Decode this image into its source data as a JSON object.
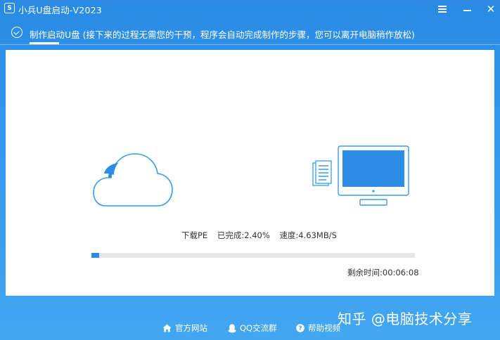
{
  "app": {
    "title": "小兵U盘启动-V2023",
    "icon_letter": "S"
  },
  "window_controls": {
    "menu": "menu-icon",
    "minimize": "minimize-icon",
    "close_glyph": "✕"
  },
  "step": {
    "text": "制作启动U盘 (接下来的过程无需您的干预，程序会自动完成制作的步骤，您可以离开电脑稍作放松)"
  },
  "progress": {
    "task_label": "下载PE",
    "completed_label": "已完成:2.40%",
    "speed_label": "速度:4.63MB/S",
    "percent": 2.4,
    "remaining_label": "剩余时间:00:06:08"
  },
  "footer": {
    "links": [
      {
        "label": "官方网站",
        "icon": "home-icon"
      },
      {
        "label": "QQ交流群",
        "icon": "qq-penguin-icon"
      },
      {
        "label": "帮助视频",
        "icon": "help-icon"
      }
    ]
  },
  "watermark": "知乎 @电脑技术分享",
  "colors": {
    "accent": "#2d8de4",
    "titlebar": "#2a8ae4",
    "track": "#e6e6e6"
  }
}
